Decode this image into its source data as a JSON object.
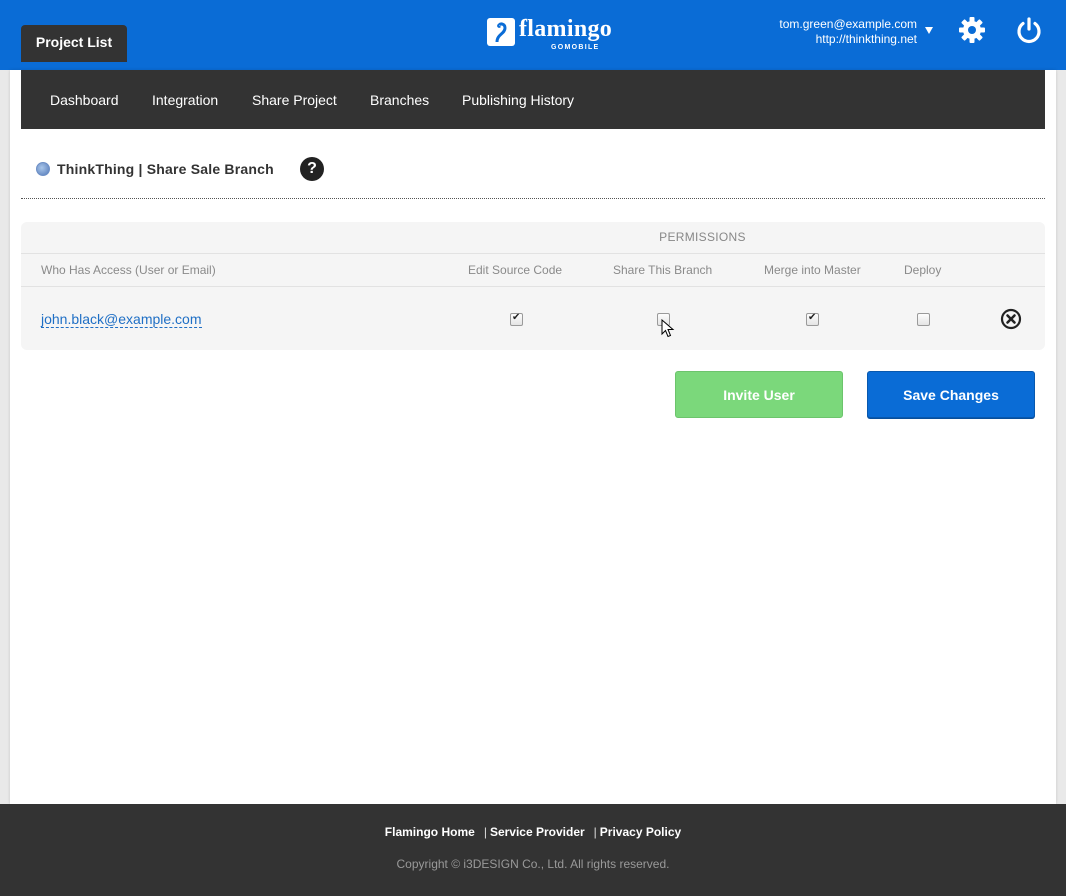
{
  "header": {
    "project_tab": "Project List",
    "logo_text": "flamingo",
    "logo_sub": "GOMOBILE",
    "user_email": "tom.green@example.com",
    "user_site": "http://thinkthing.net",
    "icons": [
      "caret-down-icon",
      "gear-icon",
      "power-icon"
    ]
  },
  "subnav": {
    "items": [
      "Dashboard",
      "Integration",
      "Share Project",
      "Branches",
      "Publishing History"
    ]
  },
  "breadcrumb": {
    "text": "ThinkThing | Share Sale Branch",
    "help": "?"
  },
  "permissions": {
    "title": "PERMISSIONS",
    "columns": [
      "Who Has Access (User or Email)",
      "Edit Source Code",
      "Share This Branch",
      "Merge into Master",
      "Deploy"
    ],
    "rows": [
      {
        "user": "john.black@example.com",
        "edit_source_code": true,
        "share_this_branch": false,
        "merge_into_master": true,
        "deploy": false
      }
    ]
  },
  "actions": {
    "invite": "Invite User",
    "save": "Save Changes"
  },
  "footer": {
    "links": [
      "Flamingo Home",
      "Service Provider",
      "Privacy Policy"
    ],
    "copyright": "Copyright © i3DESIGN Co., Ltd. All rights reserved."
  },
  "colors": {
    "brand_blue": "#0a6cd6",
    "dark_bar": "#333333",
    "invite_green": "#7bd87b"
  }
}
